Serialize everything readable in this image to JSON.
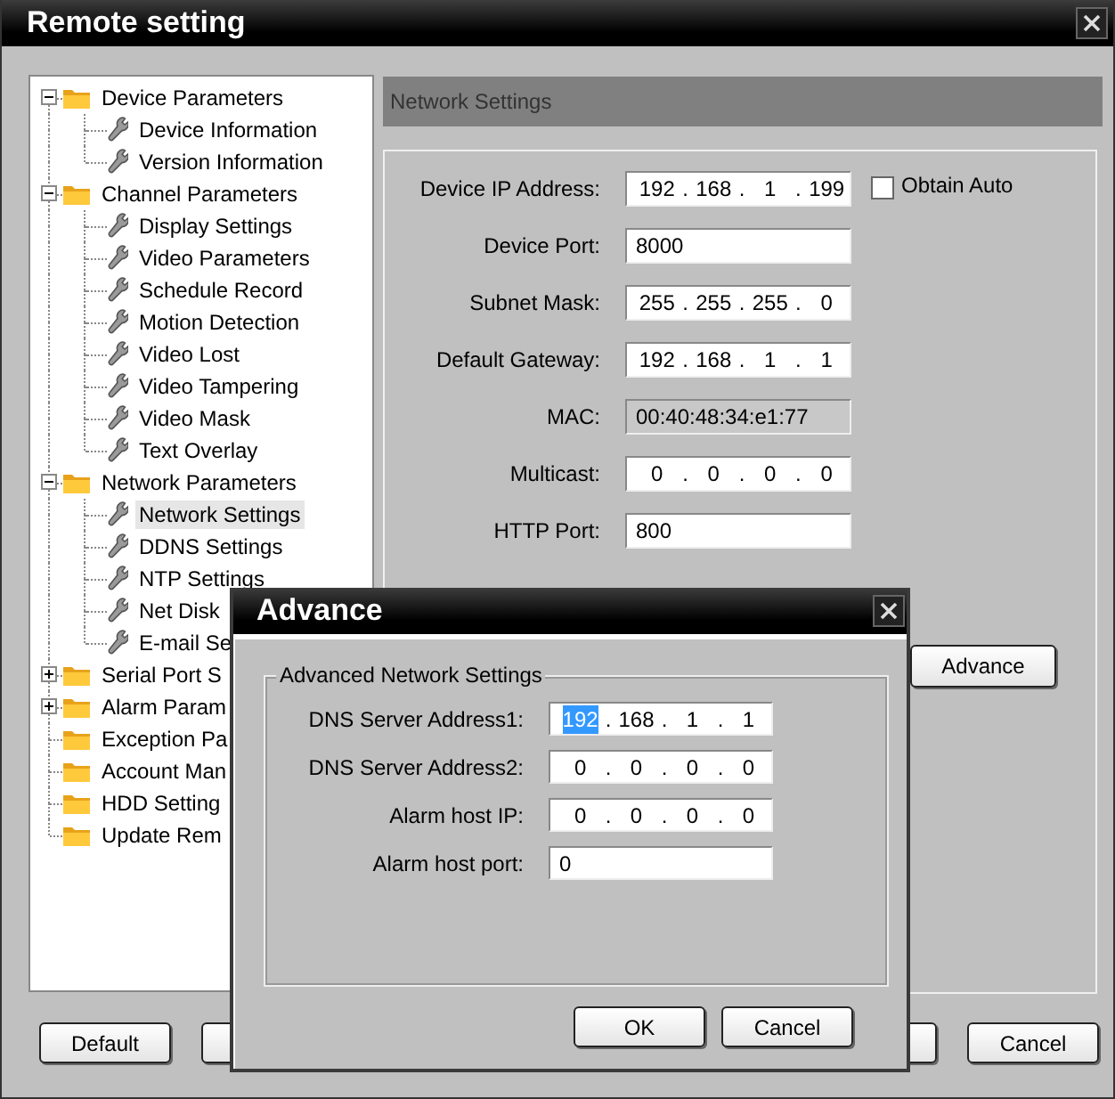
{
  "window": {
    "title": "Remote setting"
  },
  "tree": [
    {
      "label": "Device Parameters",
      "expanded": true,
      "selected": false,
      "children": [
        {
          "label": "Device Information",
          "selected": false
        },
        {
          "label": "Version Information",
          "selected": false
        }
      ]
    },
    {
      "label": "Channel Parameters",
      "expanded": true,
      "selected": false,
      "children": [
        {
          "label": "Display Settings",
          "selected": false
        },
        {
          "label": "Video Parameters",
          "selected": false
        },
        {
          "label": "Schedule Record",
          "selected": false
        },
        {
          "label": "Motion Detection",
          "selected": false
        },
        {
          "label": "Video Lost",
          "selected": false
        },
        {
          "label": "Video Tampering",
          "selected": false
        },
        {
          "label": "Video Mask",
          "selected": false
        },
        {
          "label": "Text Overlay",
          "selected": false
        }
      ]
    },
    {
      "label": "Network Parameters",
      "expanded": true,
      "selected": false,
      "children": [
        {
          "label": "Network Settings",
          "selected": true
        },
        {
          "label": "DDNS Settings",
          "selected": false
        },
        {
          "label": "NTP Settings",
          "selected": false
        },
        {
          "label": "Net Disk",
          "selected": false
        },
        {
          "label": "E-mail Se",
          "selected": false
        }
      ]
    },
    {
      "label": "Serial Port S",
      "expanded": false,
      "selected": false
    },
    {
      "label": "Alarm Param",
      "expanded": false,
      "selected": false
    },
    {
      "label": "Exception Pa",
      "selected": false
    },
    {
      "label": "Account Man",
      "selected": false
    },
    {
      "label": "HDD Setting",
      "selected": false
    },
    {
      "label": "Update Rem",
      "selected": false
    }
  ],
  "panel": {
    "title": "Network Settings",
    "fields": [
      {
        "label": "Device IP Address:",
        "kind": "ip",
        "separator": ".",
        "octets": [
          {
            "text": "192",
            "selected": false
          },
          {
            "text": "168",
            "selected": false
          },
          {
            "text": "1",
            "selected": false
          },
          {
            "text": "199",
            "selected": false
          }
        ],
        "checkbox": {
          "label": "Obtain Auto",
          "checked": false
        }
      },
      {
        "label": "Device Port:",
        "kind": "text",
        "value": "8000"
      },
      {
        "label": "Subnet Mask:",
        "kind": "ip",
        "separator": ".",
        "octets": [
          {
            "text": "255",
            "selected": false
          },
          {
            "text": "255",
            "selected": false
          },
          {
            "text": "255",
            "selected": false
          },
          {
            "text": "0",
            "selected": false
          }
        ]
      },
      {
        "label": "Default Gateway:",
        "kind": "ip",
        "separator": ".",
        "octets": [
          {
            "text": "192",
            "selected": false
          },
          {
            "text": "168",
            "selected": false
          },
          {
            "text": "1",
            "selected": false
          },
          {
            "text": "1",
            "selected": false
          }
        ]
      },
      {
        "label": "MAC:",
        "kind": "readonly",
        "value": "00:40:48:34:e1:77"
      },
      {
        "label": "Multicast:",
        "kind": "ip",
        "separator": ".",
        "octets": [
          {
            "text": "0",
            "selected": false
          },
          {
            "text": "0",
            "selected": false
          },
          {
            "text": "0",
            "selected": false
          },
          {
            "text": "0",
            "selected": false
          }
        ]
      },
      {
        "label": "HTTP Port:",
        "kind": "text",
        "value": "800"
      }
    ],
    "advance_button": "Advance"
  },
  "bottom_buttons": [
    {
      "kind": "button",
      "label": "Default"
    },
    {
      "kind": "covered"
    },
    {
      "kind": "covered"
    },
    {
      "kind": "button",
      "label": "Cancel"
    }
  ],
  "dialog": {
    "title": "Advance",
    "group": "Advanced Network Settings",
    "fields": [
      {
        "label": "DNS Server Address1:",
        "kind": "ip",
        "separator": ".",
        "octets": [
          {
            "text": "192",
            "selected": true
          },
          {
            "text": "168",
            "selected": false
          },
          {
            "text": "1",
            "selected": false
          },
          {
            "text": "1",
            "selected": false
          }
        ]
      },
      {
        "label": "DNS Server Address2:",
        "kind": "ip",
        "separator": ".",
        "octets": [
          {
            "text": "0",
            "selected": false
          },
          {
            "text": "0",
            "selected": false
          },
          {
            "text": "0",
            "selected": false
          },
          {
            "text": "0",
            "selected": false
          }
        ]
      },
      {
        "label": "Alarm host IP:",
        "kind": "ip",
        "separator": ".",
        "octets": [
          {
            "text": "0",
            "selected": false
          },
          {
            "text": "0",
            "selected": false
          },
          {
            "text": "0",
            "selected": false
          },
          {
            "text": "0",
            "selected": false
          }
        ]
      },
      {
        "label": "Alarm host port:",
        "kind": "text",
        "value": "0"
      }
    ],
    "buttons": [
      "OK",
      "Cancel"
    ]
  }
}
